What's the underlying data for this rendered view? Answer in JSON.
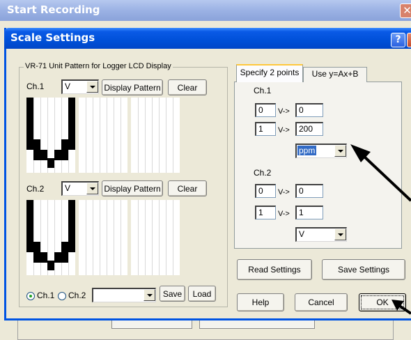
{
  "background_window": {
    "title": "Start Recording",
    "close_glyph": "✕"
  },
  "dialog": {
    "title": "Scale Settings",
    "help_glyph": "?",
    "close_glyph": "✕"
  },
  "unit_group": {
    "legend": "VR-71 Unit Pattern for Logger LCD Display",
    "ch1": {
      "label": "Ch.1",
      "unit": "V",
      "display_pattern": "Display Pattern",
      "clear": "Clear"
    },
    "ch2": {
      "label": "Ch.2",
      "unit": "V",
      "display_pattern": "Display Pattern",
      "clear": "Clear"
    },
    "radio_ch1": "Ch.1",
    "radio_ch2": "Ch.2",
    "radio_selected": "Ch.1",
    "preset_value": "",
    "save": "Save",
    "load": "Load"
  },
  "tabs": [
    {
      "label": "Specify 2 points",
      "active": true
    },
    {
      "label": "Use y=Ax+B",
      "active": false
    }
  ],
  "points": {
    "ch1": {
      "label": "Ch.1",
      "arrow": "V->",
      "row1": {
        "in": "0",
        "out": "0"
      },
      "row2": {
        "in": "1",
        "out": "200"
      },
      "unit": "ppm"
    },
    "ch2": {
      "label": "Ch.2",
      "arrow": "V->",
      "row1": {
        "in": "0",
        "out": "0"
      },
      "row2": {
        "in": "1",
        "out": "1"
      },
      "unit": "V"
    }
  },
  "buttons": {
    "read": "Read Settings",
    "save": "Save Settings",
    "help": "Help",
    "cancel": "Cancel",
    "ok": "OK"
  },
  "colors": {
    "title_blue": "#0054e3",
    "lcd_pixel": "#000000",
    "highlight": "#316ac5",
    "annotation_arrow": "#000000"
  },
  "icons": {
    "annotation": "arrow-pointer-icon"
  }
}
